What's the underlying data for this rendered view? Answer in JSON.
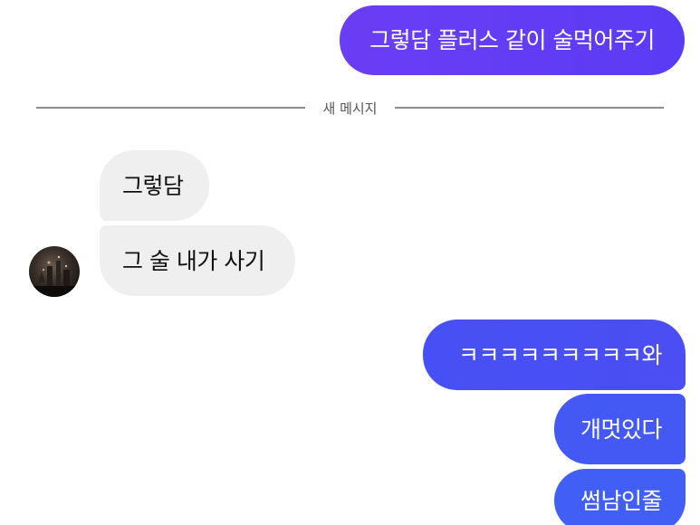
{
  "messages": {
    "m1": "그렇담 플러스 같이 술먹어주기",
    "m2": "그렇담",
    "m3": "그 술 내가 사기",
    "m4": "ㅋㅋㅋㅋㅋㅋㅋㅋㅋ와",
    "m5": "개멋있다",
    "m6": "썸남인줄"
  },
  "divider": {
    "label": "새 메시지"
  },
  "avatar": {
    "icon": "profile-photo-icon"
  },
  "colors": {
    "outgoing_top": "#6b3df5",
    "outgoing_bottom": "#415ef5",
    "incoming": "#efefef",
    "divider": "#8c8c8c"
  }
}
